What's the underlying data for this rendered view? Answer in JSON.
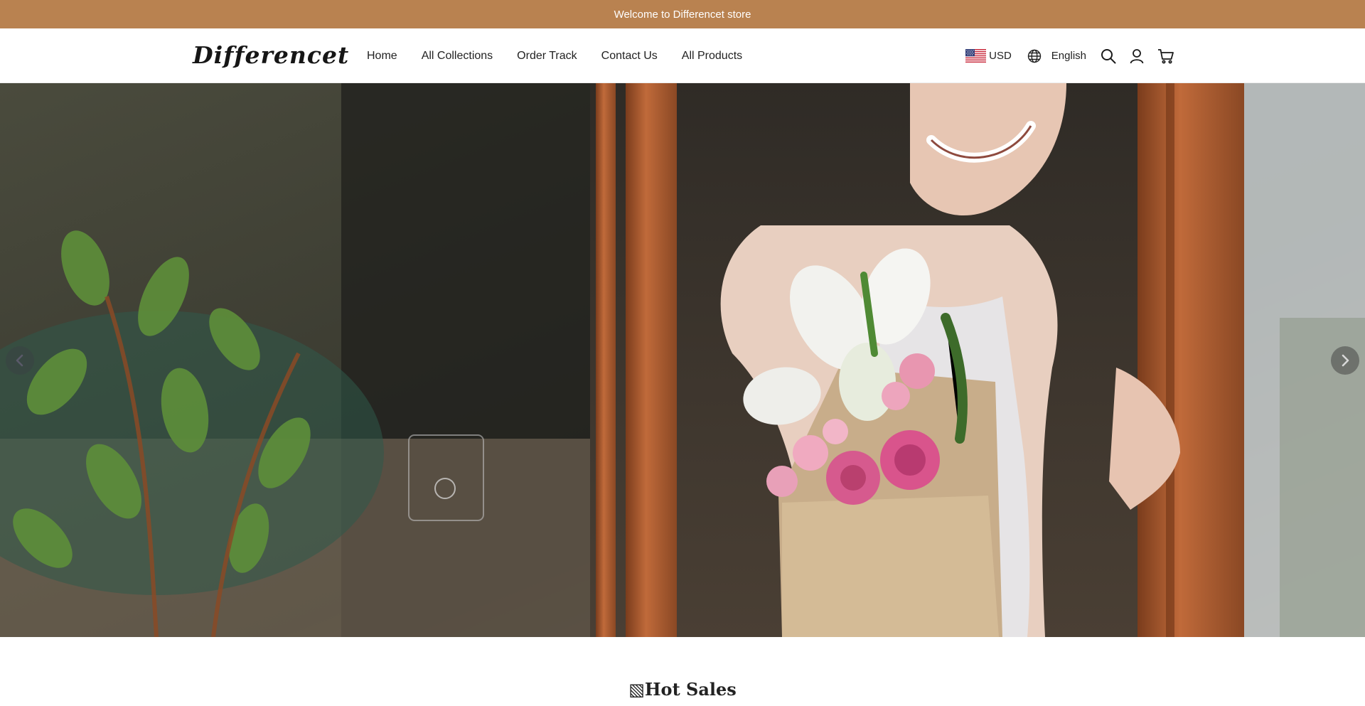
{
  "announcement": {
    "text": " Welcome to Differencet store "
  },
  "header": {
    "logo": "Differencet",
    "nav": [
      {
        "label": "Home"
      },
      {
        "label": "All Collections"
      },
      {
        "label": "Order Track"
      },
      {
        "label": "Contact Us"
      },
      {
        "label": "All Products"
      }
    ],
    "currency": {
      "code": "USD",
      "flag": "us-flag-icon"
    },
    "language": {
      "label": "English",
      "icon": "globe-icon"
    },
    "icons": [
      "search-icon",
      "account-icon",
      "cart-icon"
    ]
  },
  "hero": {
    "description": "banner-photo",
    "controls": [
      "chevron-left-icon",
      "chevron-right-icon"
    ]
  },
  "sections": {
    "hot_sales": {
      "title": "▧Hot Sales"
    }
  },
  "colors": {
    "announcement_bg": "#b98250",
    "text": "#1f1f1f",
    "background": "#ffffff"
  }
}
